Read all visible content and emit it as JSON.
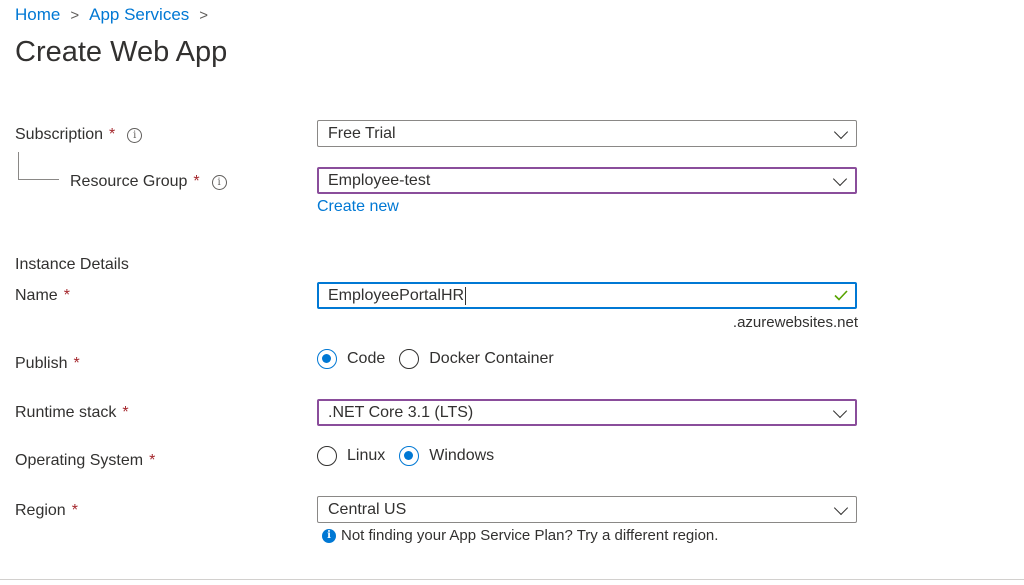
{
  "breadcrumb": [
    {
      "label": "Home"
    },
    {
      "label": "App Services"
    }
  ],
  "page_title": "Create Web App",
  "form": {
    "subscription": {
      "label": "Subscription",
      "required": "*",
      "value": "Free Trial"
    },
    "resource_group": {
      "label": "Resource Group",
      "required": "*",
      "value": "Employee-test",
      "create_new": "Create new"
    },
    "section_instance": "Instance Details",
    "name": {
      "label": "Name",
      "required": "*",
      "value": "EmployeePortalHR",
      "suffix": ".azurewebsites.net"
    },
    "publish": {
      "label": "Publish",
      "required": "*",
      "options": [
        "Code",
        "Docker Container"
      ],
      "selected": "Code"
    },
    "runtime_stack": {
      "label": "Runtime stack",
      "required": "*",
      "value": ".NET Core 3.1 (LTS)"
    },
    "operating_system": {
      "label": "Operating System",
      "required": "*",
      "options": [
        "Linux",
        "Windows"
      ],
      "selected": "Windows"
    },
    "region": {
      "label": "Region",
      "required": "*",
      "value": "Central US",
      "hint": "Not finding your App Service Plan? Try a different region."
    }
  },
  "icons": {
    "info": "info-icon",
    "chevron": "chevron-down-icon",
    "check": "check-icon"
  },
  "colors": {
    "accent": "#0078d4",
    "purple_border": "#8a4d9b",
    "required": "#a4262c",
    "success": "#57a300"
  }
}
